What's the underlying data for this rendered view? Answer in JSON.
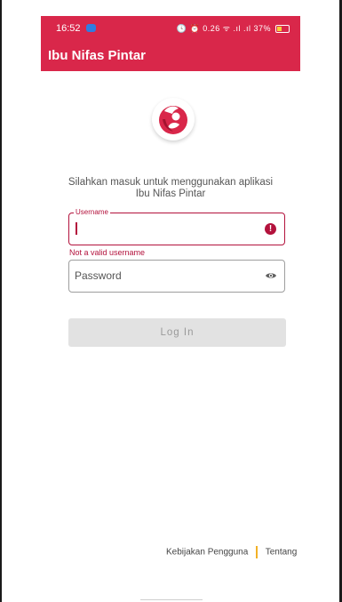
{
  "status_bar": {
    "time": "16:52",
    "right_text": "🕓 ⏰ 0.26 ᯤ .ıl .ıl 37%"
  },
  "app_bar": {
    "title": "Ibu Nifas Pintar"
  },
  "intro": {
    "line1": "Silahkan masuk untuk menggunakan aplikasi",
    "line2": "Ibu Nifas Pintar"
  },
  "form": {
    "username": {
      "label": "Username",
      "value": "",
      "error": "Not a valid username"
    },
    "password": {
      "placeholder": "Password",
      "value": ""
    },
    "login_label": "Log In"
  },
  "footer": {
    "policy_link": "Kebijakan Pengguna",
    "about_link": "Tentang"
  },
  "colors": {
    "primary": "#d9274a",
    "error": "#b3123c",
    "disabled_button": "#e2e2e2",
    "footer_separator": "#f2b126"
  },
  "icons": {
    "logo": "mother-baby-logo",
    "error": "alert-circle-icon",
    "password_toggle": "eye-icon"
  }
}
